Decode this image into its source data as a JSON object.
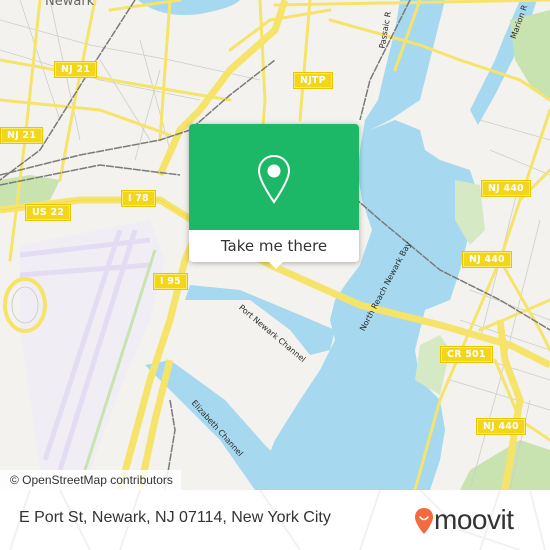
{
  "map": {
    "place_labels": [
      {
        "id": "newark",
        "text": "Newark"
      }
    ],
    "road_shields": [
      {
        "id": "nj21-a",
        "text": "NJ 21"
      },
      {
        "id": "nj21-b",
        "text": "NJ 21"
      },
      {
        "id": "njtp",
        "text": "NJTP"
      },
      {
        "id": "us22",
        "text": "US 22"
      },
      {
        "id": "i78",
        "text": "I 78"
      },
      {
        "id": "i95",
        "text": "I 95"
      },
      {
        "id": "nj440-a",
        "text": "NJ 440"
      },
      {
        "id": "nj440-b",
        "text": "NJ 440"
      },
      {
        "id": "cr501",
        "text": "CR 501"
      },
      {
        "id": "nj440-c",
        "text": "NJ 440"
      }
    ],
    "water_labels": [
      {
        "id": "passaic",
        "text": "Passaic R"
      },
      {
        "id": "marion",
        "text": "Marion R"
      },
      {
        "id": "port-newark-channel",
        "text": "Port Newark Channel"
      },
      {
        "id": "elizabeth-channel",
        "text": "Elizabeth Channel"
      },
      {
        "id": "north-reach",
        "text": "North Reach Newark Bay"
      }
    ],
    "colors": {
      "land": "#f3f2ee",
      "water": "#a6d9ef",
      "park": "#c9e3b0",
      "road_major": "#f6e46a",
      "road_minor": "#c8c8c8",
      "rail": "#7a7a7a",
      "airport": "#e4dcf3"
    },
    "attribution": "© OpenStreetMap contributors"
  },
  "popup": {
    "icon": "map-pin-icon",
    "cta_label": "Take me there",
    "color": "#1db867"
  },
  "footer": {
    "address": "E Port St, Newark, NJ 07114, New York City",
    "brand": "moovit",
    "brand_color": "#f26a3d"
  }
}
